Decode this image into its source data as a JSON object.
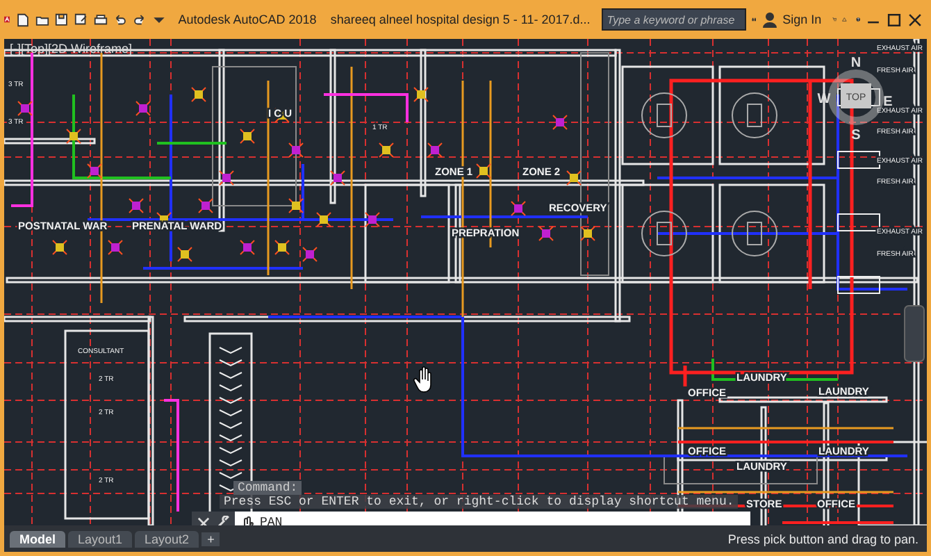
{
  "app": {
    "title": "Autodesk AutoCAD 2018",
    "document": "shareeq alneel hospital design 5 -  11- 2017.d...",
    "search": {
      "placeholder": "Type a keyword or phrase"
    },
    "sign_in": "Sign In"
  },
  "viewport": {
    "label": "[-][Top][2D Wireframe]"
  },
  "drawing": {
    "labels": [
      {
        "kind": "room",
        "text": "I C U"
      },
      {
        "kind": "room",
        "text": "ZONE 1"
      },
      {
        "kind": "room",
        "text": "ZONE 2"
      },
      {
        "kind": "room",
        "text": "RECOVERY"
      },
      {
        "kind": "room",
        "text": "POSTNATAL WAR"
      },
      {
        "kind": "room",
        "text": "PRENATAL WARD"
      },
      {
        "kind": "room",
        "text": "PREPRATION"
      },
      {
        "kind": "small",
        "text": "CONSULTANT"
      },
      {
        "kind": "room",
        "text": "LAUNDRY"
      },
      {
        "kind": "room",
        "text": "LAUNDRY"
      },
      {
        "kind": "room",
        "text": "LAUNDRY"
      },
      {
        "kind": "room",
        "text": "LAUNDRY"
      },
      {
        "kind": "room",
        "text": "OFFICE"
      },
      {
        "kind": "room",
        "text": "OFFICE"
      },
      {
        "kind": "room",
        "text": "STORE"
      },
      {
        "kind": "room",
        "text": "OFFICE"
      },
      {
        "kind": "small",
        "text": "3 TR"
      },
      {
        "kind": "small",
        "text": "3 TR"
      },
      {
        "kind": "small",
        "text": "1 TR"
      },
      {
        "kind": "small",
        "text": "2 TR"
      },
      {
        "kind": "small",
        "text": "2 TR"
      },
      {
        "kind": "small",
        "text": "2 TR"
      },
      {
        "kind": "small",
        "text": "EXHAUST AIR"
      },
      {
        "kind": "small",
        "text": "FRESH AIR"
      },
      {
        "kind": "small",
        "text": "EXHAUST AIR"
      },
      {
        "kind": "small",
        "text": "FRESH AIR"
      },
      {
        "kind": "small",
        "text": "EXHAUST AIR"
      },
      {
        "kind": "small",
        "text": "FRESH AIR"
      },
      {
        "kind": "small",
        "text": "EXHAUST AIR"
      },
      {
        "kind": "small",
        "text": "FRESH AIR"
      }
    ]
  },
  "viewcube": {
    "face": "TOP",
    "north": "N",
    "west": "W",
    "east": "E",
    "south": "S"
  },
  "command": {
    "prompt": "Command:",
    "history": "Press ESC or ENTER to exit, or right-click to display shortcut menu.",
    "input": "PAN"
  },
  "layout_tabs": [
    {
      "label": "Model",
      "selected": true
    },
    {
      "label": "Layout1",
      "selected": false
    },
    {
      "label": "Layout2",
      "selected": false
    }
  ],
  "add_tab": "+",
  "status_bar": {
    "message": "Press pick button and drag to pan."
  }
}
